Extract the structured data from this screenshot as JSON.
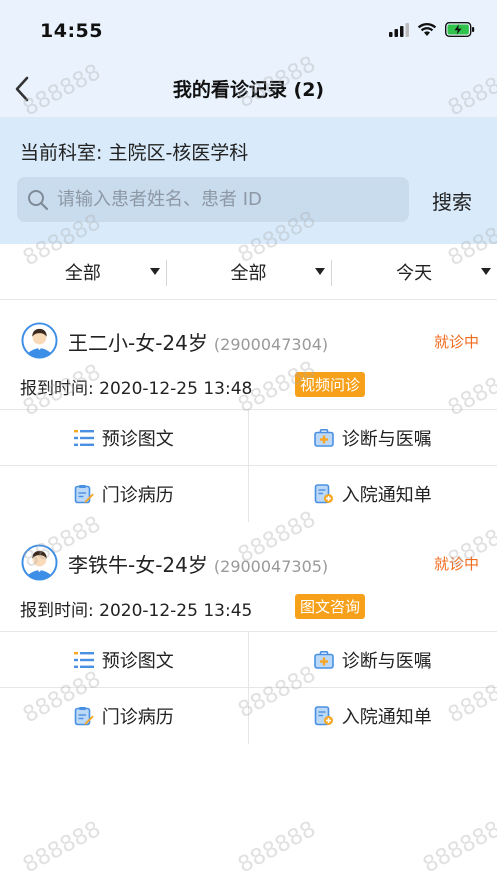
{
  "status_bar": {
    "time": "14:55"
  },
  "nav": {
    "title": "我的看诊记录 (2)"
  },
  "dept": {
    "label": "当前科室: 主院区-核医学科"
  },
  "search": {
    "placeholder": "请输入患者姓名、患者 ID",
    "button_label": "搜索"
  },
  "filters": [
    {
      "label": "全部"
    },
    {
      "label": "全部"
    },
    {
      "label": "今天"
    }
  ],
  "records": [
    {
      "name": "王二小-女-24岁",
      "patient_id": "(2900047304)",
      "status": "就诊中",
      "report_time": "报到时间: 2020-12-25 13:48",
      "type_tag": "视频问诊"
    },
    {
      "name": "李铁牛-女-24岁",
      "patient_id": "(2900047305)",
      "status": "就诊中",
      "report_time": "报到时间: 2020-12-25 13:45",
      "type_tag": "图文咨询"
    }
  ],
  "actions": {
    "pre_consult": "预诊图文",
    "diagnosis": "诊断与医嘱",
    "outpatient_record": "门诊病历",
    "admission_notice": "入院通知单"
  },
  "watermark": {
    "text": "888888"
  },
  "colors": {
    "accent_orange": "#f26b1d",
    "tag_orange": "#f7a11a",
    "header_bg": "#eaf3fd",
    "panel_bg": "#d9ebfb",
    "icon_blue": "#4a90e2"
  }
}
